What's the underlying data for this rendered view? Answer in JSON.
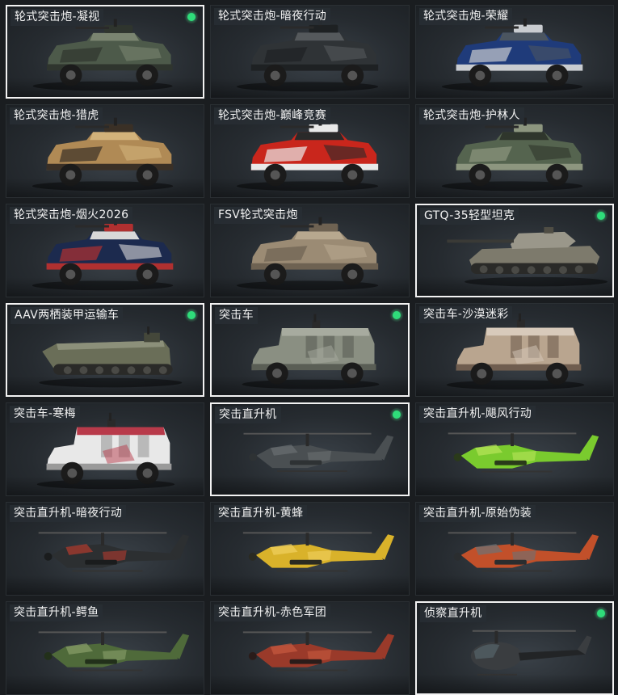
{
  "cards": [
    {
      "label": "轮式突击炮-凝视",
      "selected": true,
      "owned": true,
      "kind": "fsv",
      "colors": [
        "#4d5a4a",
        "#2f352e",
        "#7a8470"
      ]
    },
    {
      "label": "轮式突击炮-暗夜行动",
      "selected": false,
      "owned": false,
      "kind": "fsv",
      "colors": [
        "#2f3336",
        "#1e2123",
        "#55595c"
      ]
    },
    {
      "label": "轮式突击炮-荣耀",
      "selected": false,
      "owned": false,
      "kind": "fsv",
      "colors": [
        "#1f3b7a",
        "#c9ccd0",
        "#4b5560"
      ]
    },
    {
      "label": "轮式突击炮-猎虎",
      "selected": false,
      "owned": false,
      "kind": "fsv",
      "colors": [
        "#b08a55",
        "#3a3026",
        "#d2b27a"
      ]
    },
    {
      "label": "轮式突击炮-巅峰竞赛",
      "selected": false,
      "owned": false,
      "kind": "fsv",
      "colors": [
        "#c9261c",
        "#e9e9e9",
        "#2a2a2a"
      ]
    },
    {
      "label": "轮式突击炮-护林人",
      "selected": false,
      "owned": false,
      "kind": "fsv",
      "colors": [
        "#55644f",
        "#8d967f",
        "#2f362c"
      ]
    },
    {
      "label": "轮式突击炮-烟火2026",
      "selected": false,
      "owned": false,
      "kind": "fsv",
      "colors": [
        "#1c2a4e",
        "#b03030",
        "#d8d8d8"
      ]
    },
    {
      "label": "FSV轮式突击炮",
      "selected": false,
      "owned": false,
      "kind": "fsv",
      "colors": [
        "#9b8b74",
        "#6e6252",
        "#b7a88f"
      ]
    },
    {
      "label": "GTQ-35轻型坦克",
      "selected": true,
      "owned": true,
      "kind": "tank",
      "colors": [
        "#7d7a6c",
        "#4f4d44",
        "#9a978a"
      ]
    },
    {
      "label": "AAV两栖装甲运输车",
      "selected": true,
      "owned": true,
      "kind": "aav",
      "colors": [
        "#6a6e58",
        "#44473a",
        "#8c907a"
      ]
    },
    {
      "label": "突击车",
      "selected": true,
      "owned": true,
      "kind": "assault",
      "colors": [
        "#8a8f82",
        "#5a5e55",
        "#a7ab9f"
      ]
    },
    {
      "label": "突击车-沙漠迷彩",
      "selected": false,
      "owned": false,
      "kind": "assault",
      "colors": [
        "#b9a58f",
        "#6f5d4f",
        "#d8cabb"
      ]
    },
    {
      "label": "突击车-寒梅",
      "selected": false,
      "owned": false,
      "kind": "assault",
      "colors": [
        "#e8e8e8",
        "#9a9a9a",
        "#b83a4a"
      ]
    },
    {
      "label": "突击直升机",
      "selected": true,
      "owned": true,
      "kind": "heli",
      "colors": [
        "#4a4f52",
        "#2e3234",
        "#6a6f72"
      ]
    },
    {
      "label": "突击直升机-飓风行动",
      "selected": false,
      "owned": false,
      "kind": "heli",
      "colors": [
        "#7acb2e",
        "#2a3a1a",
        "#b8e45a"
      ]
    },
    {
      "label": "突击直升机-暗夜行动",
      "selected": false,
      "owned": false,
      "kind": "heli",
      "colors": [
        "#2c2f31",
        "#1a1c1d",
        "#b23a2e"
      ]
    },
    {
      "label": "突击直升机-黄蜂",
      "selected": false,
      "owned": false,
      "kind": "heli",
      "colors": [
        "#d9b22a",
        "#2a2a22",
        "#f0d060"
      ]
    },
    {
      "label": "突击直升机-原始伪装",
      "selected": false,
      "owned": false,
      "kind": "heli",
      "colors": [
        "#c2502a",
        "#2a2d2f",
        "#6b7276"
      ]
    },
    {
      "label": "突击直升机-鳄鱼",
      "selected": false,
      "owned": false,
      "kind": "heli",
      "colors": [
        "#4f6a3a",
        "#22301a",
        "#8aa06a"
      ]
    },
    {
      "label": "突击直升机-赤色军团",
      "selected": false,
      "owned": false,
      "kind": "heli",
      "colors": [
        "#9a3a2a",
        "#2a1c1a",
        "#c85a40"
      ]
    },
    {
      "label": "侦察直升机",
      "selected": true,
      "owned": true,
      "kind": "scout",
      "colors": [
        "#3a3d40",
        "#222426",
        "#5a5e62"
      ]
    }
  ],
  "icons": {
    "owned": "owned-indicator-icon"
  }
}
